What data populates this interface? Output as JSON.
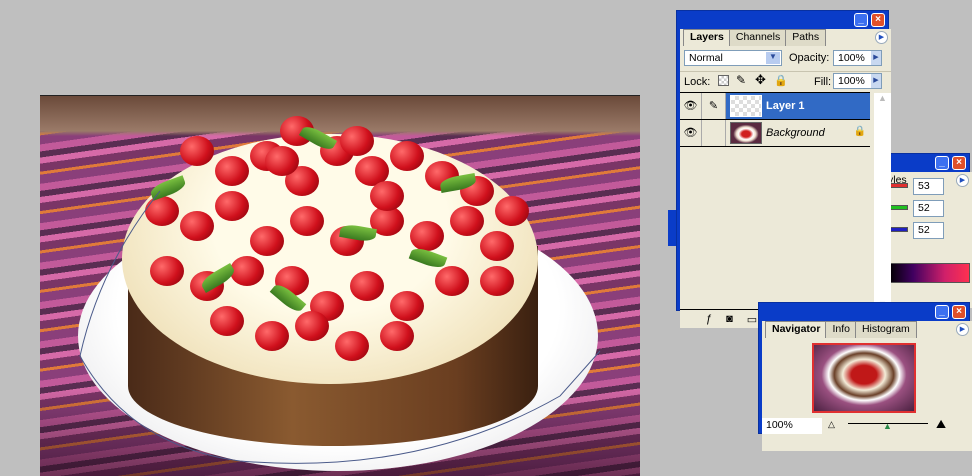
{
  "layers_panel": {
    "tabs": [
      "Layers",
      "Channels",
      "Paths"
    ],
    "blend_mode": "Normal",
    "opacity_label": "Opacity:",
    "opacity": "100%",
    "lock_label": "Lock:",
    "fill_label": "Fill:",
    "fill": "100%",
    "layers": [
      {
        "name": "Layer 1",
        "selected": true
      },
      {
        "name": "Background",
        "locked": true
      }
    ]
  },
  "color_panel": {
    "tab_partial": "yles",
    "values": [
      "53",
      "52",
      "52"
    ],
    "colors": [
      "#e03030",
      "#20c020",
      "#2020c0"
    ]
  },
  "navigator_panel": {
    "tabs": [
      "Navigator",
      "Info",
      "Histogram"
    ],
    "zoom": "100%",
    "zoom_slider": 0.5
  },
  "window_buttons": {
    "minimize": "_",
    "close": "×"
  }
}
